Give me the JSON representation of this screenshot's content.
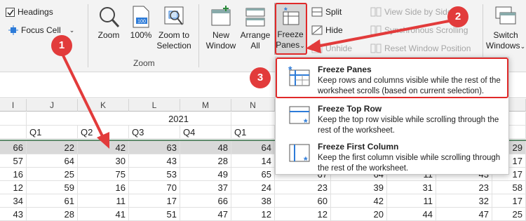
{
  "ribbon": {
    "headings_label": "Headings",
    "focus_cell_label": "Focus Cell",
    "zoom_label": "Zoom",
    "zoom100_label": "100%",
    "zoom_selection_label": [
      "Zoom to",
      "Selection"
    ],
    "zoom_group_label": "Zoom",
    "new_window_label": [
      "New",
      "Window"
    ],
    "arrange_all_label": [
      "Arrange",
      "All"
    ],
    "freeze_panes_label": [
      "Freeze",
      "Panes"
    ],
    "split_label": "Split",
    "hide_label": "Hide",
    "unhide_label": "Unhide",
    "view_side_by_side_label": "View Side by Side",
    "sync_scrolling_label": "Synchronous Scrolling",
    "reset_window_label": "Reset Window Position",
    "switch_windows_label": [
      "Switch",
      "Windows"
    ]
  },
  "grid": {
    "columns": [
      "I",
      "J",
      "K",
      "L",
      "M",
      "N"
    ],
    "year_label": "2021",
    "quarters": [
      "Q1",
      "Q2",
      "Q3",
      "Q4",
      "Q1"
    ],
    "rows": [
      [
        "66",
        "22",
        "42",
        "63",
        "48",
        "64"
      ],
      [
        "57",
        "64",
        "30",
        "43",
        "28",
        "14"
      ],
      [
        "16",
        "25",
        "75",
        "53",
        "49",
        "65"
      ],
      [
        "12",
        "59",
        "16",
        "70",
        "37",
        "24"
      ],
      [
        "34",
        "61",
        "11",
        "17",
        "66",
        "38"
      ],
      [
        "43",
        "28",
        "41",
        "51",
        "47",
        "12"
      ]
    ],
    "right_rows": [
      [
        "",
        "",
        "",
        "",
        "29"
      ],
      [
        "",
        "",
        "",
        "",
        "17"
      ],
      [
        "67",
        "64",
        "11",
        "43",
        "17"
      ],
      [
        "23",
        "39",
        "31",
        "23",
        "58"
      ],
      [
        "60",
        "42",
        "11",
        "32",
        "17"
      ],
      [
        "12",
        "20",
        "44",
        "47",
        "25"
      ]
    ]
  },
  "menu": {
    "items": [
      {
        "title": "Freeze Panes",
        "desc": "Keep rows and columns visible while the rest of the worksheet scrolls (based on current selection)."
      },
      {
        "title": "Freeze Top Row",
        "desc": "Keep the top row visible while scrolling through the rest of the worksheet."
      },
      {
        "title": "Freeze First Column",
        "desc": "Keep the first column visible while scrolling through the rest of the worksheet."
      }
    ]
  },
  "annotations": {
    "badges": [
      "1",
      "2",
      "3"
    ],
    "color": "#e23b3b"
  }
}
